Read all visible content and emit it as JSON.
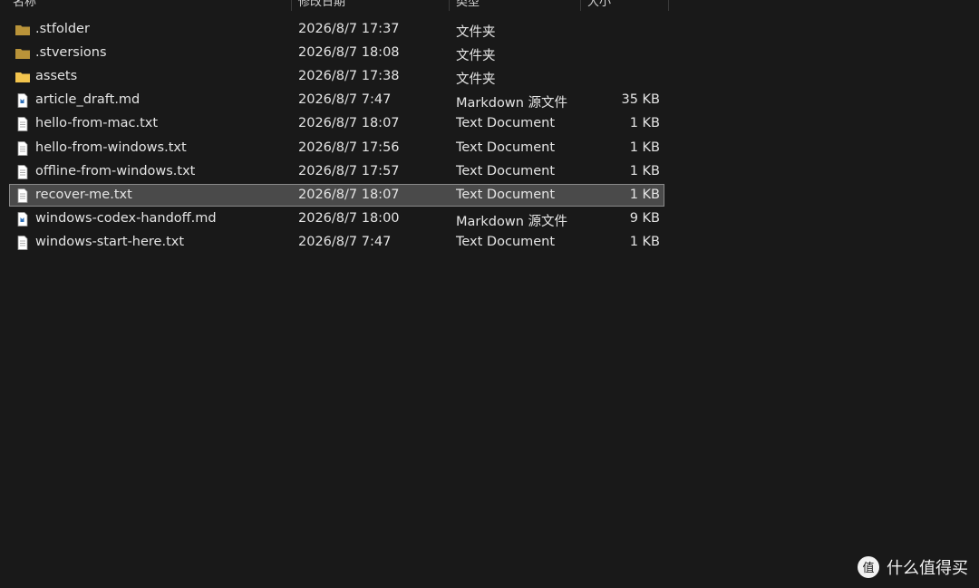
{
  "header": {
    "columns": [
      {
        "label": "名称"
      },
      {
        "label": "修改日期"
      },
      {
        "label": "类型"
      },
      {
        "label": "大小"
      }
    ]
  },
  "files": [
    {
      "name": ".stfolder",
      "date": "2026/8/7 17:37",
      "type": "文件夹",
      "size": "",
      "icon": "folder-dark-icon",
      "selected": false
    },
    {
      "name": ".stversions",
      "date": "2026/8/7 18:08",
      "type": "文件夹",
      "size": "",
      "icon": "folder-dark-icon",
      "selected": false
    },
    {
      "name": "assets",
      "date": "2026/8/7 17:38",
      "type": "文件夹",
      "size": "",
      "icon": "folder-icon",
      "selected": false
    },
    {
      "name": "article_draft.md",
      "date": "2026/8/7 7:47",
      "type": "Markdown 源文件",
      "size": "35 KB",
      "icon": "markdown-file-icon",
      "selected": false
    },
    {
      "name": "hello-from-mac.txt",
      "date": "2026/8/7 18:07",
      "type": "Text Document",
      "size": "1 KB",
      "icon": "text-file-icon",
      "selected": false
    },
    {
      "name": "hello-from-windows.txt",
      "date": "2026/8/7 17:56",
      "type": "Text Document",
      "size": "1 KB",
      "icon": "text-file-icon",
      "selected": false
    },
    {
      "name": "offline-from-windows.txt",
      "date": "2026/8/7 17:57",
      "type": "Text Document",
      "size": "1 KB",
      "icon": "text-file-icon",
      "selected": false
    },
    {
      "name": "recover-me.txt",
      "date": "2026/8/7 18:07",
      "type": "Text Document",
      "size": "1 KB",
      "icon": "text-file-icon",
      "selected": true
    },
    {
      "name": "windows-codex-handoff.md",
      "date": "2026/8/7 18:00",
      "type": "Markdown 源文件",
      "size": "9 KB",
      "icon": "markdown-file-icon",
      "selected": false
    },
    {
      "name": "windows-start-here.txt",
      "date": "2026/8/7 7:47",
      "type": "Text Document",
      "size": "1 KB",
      "icon": "text-file-icon",
      "selected": false
    }
  ],
  "colors": {
    "background": "#191919",
    "folder": "#f2c44e",
    "folder_dark": "#b8933a",
    "selection": "#4a4a4a"
  },
  "watermark": {
    "text": "什么值得买",
    "logo_glyph": "值"
  }
}
